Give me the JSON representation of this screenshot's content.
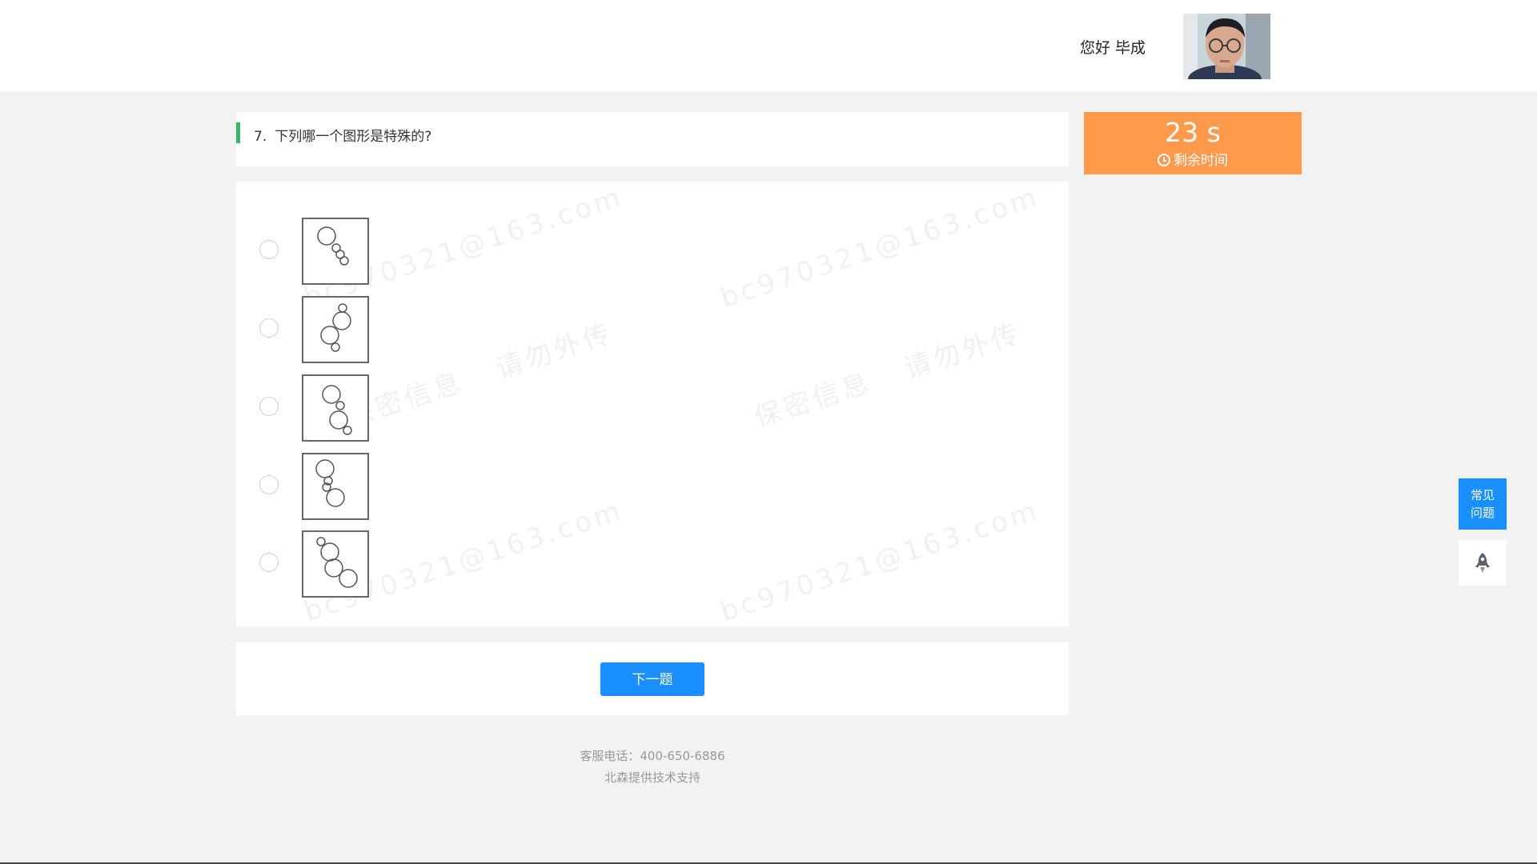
{
  "header": {
    "greeting": "您好",
    "user_name": "毕成"
  },
  "question": {
    "number": "7.",
    "text": "下列哪一个图形是特殊的?"
  },
  "timer": {
    "value": "23 s",
    "label": "剩余时间",
    "accent_color": "#ff9a4d"
  },
  "watermark": {
    "email": "bc970321@163.com",
    "text1": "保密信息",
    "text2": "请勿外传"
  },
  "options": [
    {
      "name": "option-1",
      "icon": "circles-figure-1",
      "selected": false
    },
    {
      "name": "option-2",
      "icon": "circles-figure-2",
      "selected": false
    },
    {
      "name": "option-3",
      "icon": "circles-figure-3",
      "selected": false
    },
    {
      "name": "option-4",
      "icon": "circles-figure-4",
      "selected": false
    },
    {
      "name": "option-5",
      "icon": "circles-figure-5",
      "selected": false
    }
  ],
  "actions": {
    "next_label": "下一题",
    "primary_color": "#1a8fff"
  },
  "footer": {
    "phone": "客服电话：400-650-6886",
    "support": "北森提供技术支持"
  },
  "side": {
    "help_line1": "常见",
    "help_line2": "问题",
    "top_icon": "rocket-icon"
  }
}
